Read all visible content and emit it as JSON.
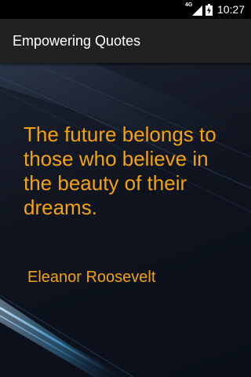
{
  "status_bar": {
    "network": "4G",
    "time": "10:27"
  },
  "app_bar": {
    "title": "Empowering Quotes"
  },
  "quote": {
    "text": "The future belongs to those who believe in the beauty of their dreams.",
    "author": "Eleanor Roosevelt"
  },
  "colors": {
    "app_bar": "#212121",
    "quote_text": "#f5a20f",
    "background": "#0e131d",
    "accent_streak": "#4aa8e0"
  },
  "icons": [
    "signal-icon",
    "battery-charging-icon"
  ]
}
